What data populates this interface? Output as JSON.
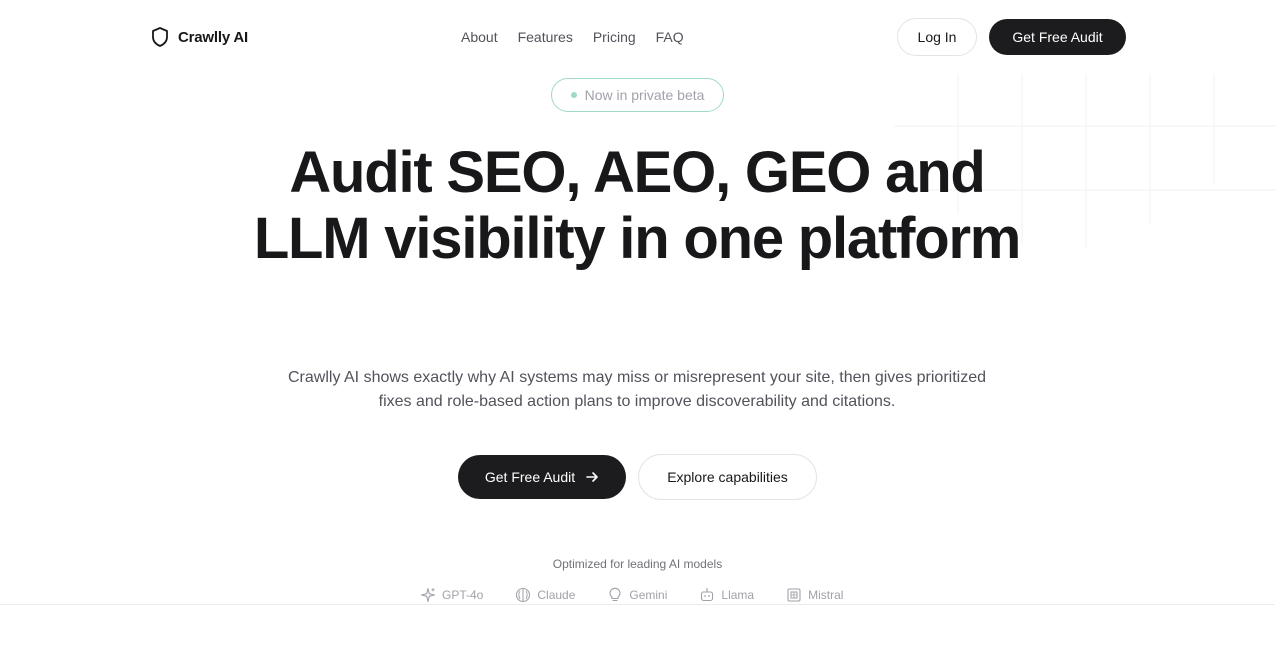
{
  "nav": {
    "brand": "Crawlly AI",
    "links": [
      "About",
      "Features",
      "Pricing",
      "FAQ"
    ],
    "login_label": "Log In",
    "cta_label": "Get Free Audit"
  },
  "hero": {
    "badge": "Now in private beta",
    "title": "Audit SEO, AEO, GEO and LLM visibility in one platform",
    "subtitle": "Crawlly AI shows exactly why AI systems may miss or misrepresent your site, then gives prioritized fixes and role-based action plans to improve discoverability and citations.",
    "primary_cta": "Get Free Audit",
    "secondary_cta": "Explore capabilities"
  },
  "models": {
    "caption": "Optimized for leading AI models",
    "items": [
      {
        "label": "GPT-4o",
        "icon": "sparkle-icon"
      },
      {
        "label": "Claude",
        "icon": "brain-icon"
      },
      {
        "label": "Gemini",
        "icon": "lightbulb-icon"
      },
      {
        "label": "Llama",
        "icon": "bot-icon"
      },
      {
        "label": "Mistral",
        "icon": "chip-icon"
      }
    ]
  },
  "colors": {
    "primary": "#1c1c1e",
    "badge_accent": "#9fdac5",
    "muted_text": "#a1a1aa"
  }
}
